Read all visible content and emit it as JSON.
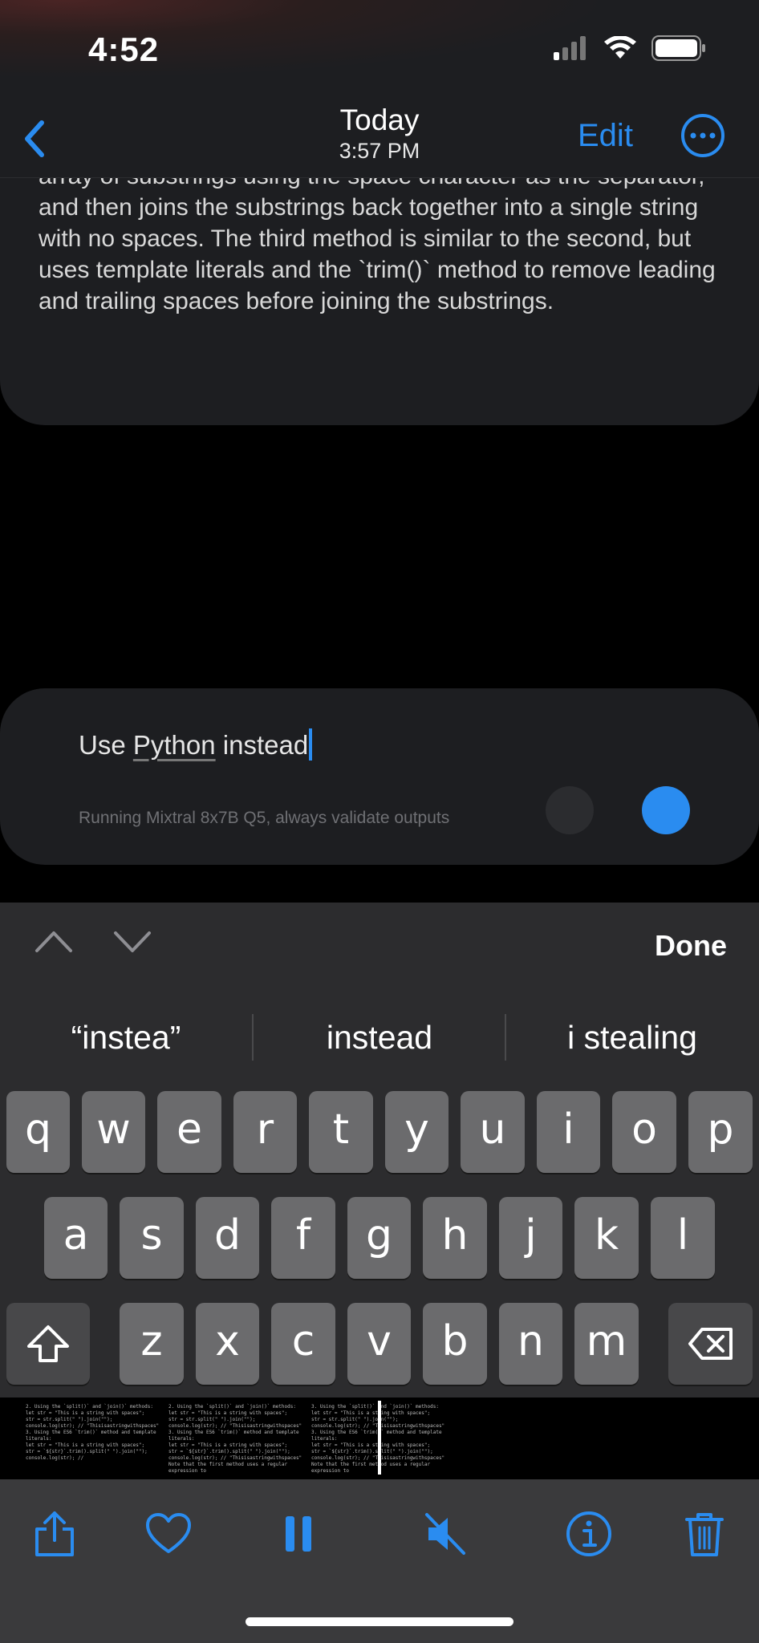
{
  "status_bar": {
    "time": "4:52",
    "icons": [
      "signal-icon",
      "wifi-icon",
      "battery-icon"
    ]
  },
  "nav": {
    "title": "Today",
    "subtitle": "3:57 PM",
    "edit_label": "Edit",
    "icons": [
      "chevron-left-icon",
      "more-icon"
    ]
  },
  "message": {
    "text": "array of substrings using the space character as the separator, and then joins the substrings back together into a single string with no spaces. The third method is similar to the second, but uses template literals and the `trim()` method to remove leading and trailing spaces before joining the substrings."
  },
  "input": {
    "prefix": "Use ",
    "underlined_word": "Python",
    "suffix": " instead",
    "hint": "Running Mixtral 8x7B Q5, always validate outputs"
  },
  "keyboard": {
    "done_label": "Done",
    "suggestions": [
      "“instea”",
      "instead",
      "i stealing"
    ],
    "row1": [
      "q",
      "w",
      "e",
      "r",
      "t",
      "y",
      "u",
      "i",
      "o",
      "p"
    ],
    "row2": [
      "a",
      "s",
      "d",
      "f",
      "g",
      "h",
      "j",
      "k",
      "l"
    ],
    "row3": [
      "z",
      "x",
      "c",
      "v",
      "b",
      "n",
      "m"
    ]
  },
  "preview": {
    "columns": [
      [
        "2. Using the `split()` and `join()` methods:",
        "let str = \"This is a string with spaces\";",
        "str = str.split(\" \").join(\"\");",
        "console.log(str); // \"Thisisastringwithspaces\"",
        "3. Using the ES6 `trim()` method and template literals:",
        "let str = \"This is a string with spaces\";",
        "str = `${str}`.trim().split(\" \").join(\"\");",
        "console.log(str); //"
      ],
      [
        "2. Using the `split()` and `join()` methods:",
        "let str = \"This is a string with spaces\";",
        "str = str.split(\" \").join(\"\");",
        "console.log(str); // \"Thisisastringwithspaces\"",
        "3. Using the ES6 `trim()` method and template literals:",
        "let str = \"This is a string with spaces\";",
        "str = `${str}`.trim().split(\" \").join(\"\");",
        "console.log(str); // \"Thisisastringwithspaces\"",
        "Note that the first method uses a regular expression to"
      ],
      [
        "3. Using the `split()` and `join()` methods:",
        "let str = \"This is a string with spaces\";",
        "str = str.split(\" \").join(\"\");",
        "console.log(str); // \"Thisisastringwithspaces\"",
        "3. Using the ES6 `trim()` method and template literals:",
        "let str = \"This is a string with spaces\";",
        "str = `${str}`.trim().split(\" \").join(\"\");",
        "console.log(str); // \"Thisisastringwithspaces\"",
        "Note that the first method uses a regular expression to"
      ]
    ]
  },
  "bottom_bar": {
    "icons": [
      "share-icon",
      "heart-icon",
      "pause-icon",
      "mute-icon",
      "info-icon",
      "trash-icon"
    ]
  },
  "colors": {
    "accent": "#2a8cf0",
    "card": "#1d1e21",
    "keyboard": "#2c2c2e",
    "key": "#6b6b6d"
  }
}
